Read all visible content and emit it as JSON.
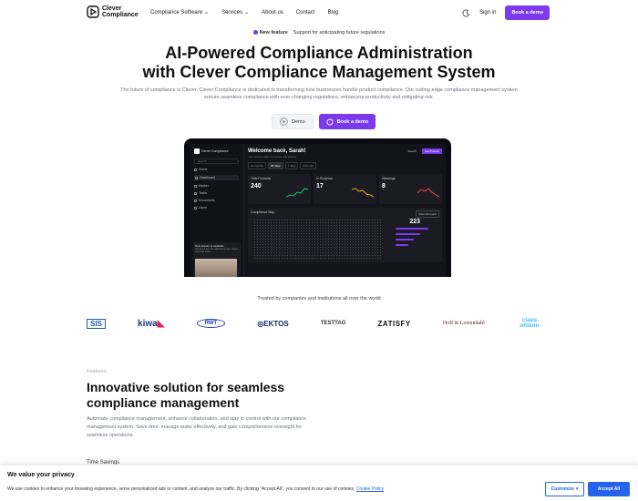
{
  "nav": {
    "brand": "Clever Compliance",
    "links": [
      "Compliance Software",
      "Services",
      "About us",
      "Contact",
      "Blog"
    ],
    "signin": "Sign in",
    "cta": "Book a demo"
  },
  "badge": {
    "label": "New feature",
    "text": "Support for anticipating future regulations"
  },
  "hero": {
    "title_line1": "AI-Powered Compliance Administration",
    "title_line2": "with Clever Compliance Management System",
    "subtitle": "The future of compliance is Clever. Clever Compliance is dedicated to transforming how businesses handle product compliance. Our cutting-edge compliance management system ensure seamless compliance with ever-changing regulations, enhancing productivity and mitigating risk.",
    "demo_label": "Demo",
    "book_label": "Book a demo"
  },
  "dashboard": {
    "brand": "Clever Compliance",
    "search": "Search",
    "menu": [
      "Home",
      "Dashboard",
      "Market",
      "Tasks",
      "Documents",
      "Users"
    ],
    "card_title": "New feature is available",
    "card_text": "Check out the new dashboard view. Pages now load faster.",
    "welcome": "Welcome back, Sarah!",
    "welcome_sub": "Your current sales summary and activity.",
    "top_buttons": [
      "Search",
      "Get Product"
    ],
    "tabs": [
      "12 months",
      "30 days",
      "7 days",
      "24 hours"
    ],
    "stats": [
      {
        "title": "Total Products",
        "value": "240",
        "color": "#22c55e"
      },
      {
        "title": "In Progress",
        "value": "17",
        "color": "#eab308"
      },
      {
        "title": "Warnings",
        "value": "8",
        "color": "#ef4444"
      }
    ],
    "map_title": "Compliance Map",
    "map_button": "View full report",
    "map_value": "223"
  },
  "trusted": {
    "text": "Trusted by companies and institutions all over the world",
    "logos": [
      "SIS",
      "kiwa",
      "RWT",
      "EKTOS",
      "TESTTAG",
      "ZATISFY",
      "Hoff & Lowendahl",
      "claes ohlson"
    ]
  },
  "features": {
    "label": "Features",
    "title": "Innovative solution for seamless compliance management",
    "text": "Automate compliance management, enhance collaboration, and stay in control with our compliance management system. Save time, manage tasks effectively, and gain comprehensive oversight for seamless operations.",
    "partial": "Time Savings"
  },
  "cookie": {
    "title": "We value your privacy",
    "text": "We use cookies to enhance your browsing experience, serve personalized ads or content, and analyze our traffic. By clicking \"Accept All\", you consent to our use of cookies.",
    "policy_link": "Cookie Policy",
    "customize": "Customize",
    "accept": "Accept All"
  },
  "colors": {
    "accent": "#7c3aed",
    "cookie_blue": "#2563eb"
  }
}
